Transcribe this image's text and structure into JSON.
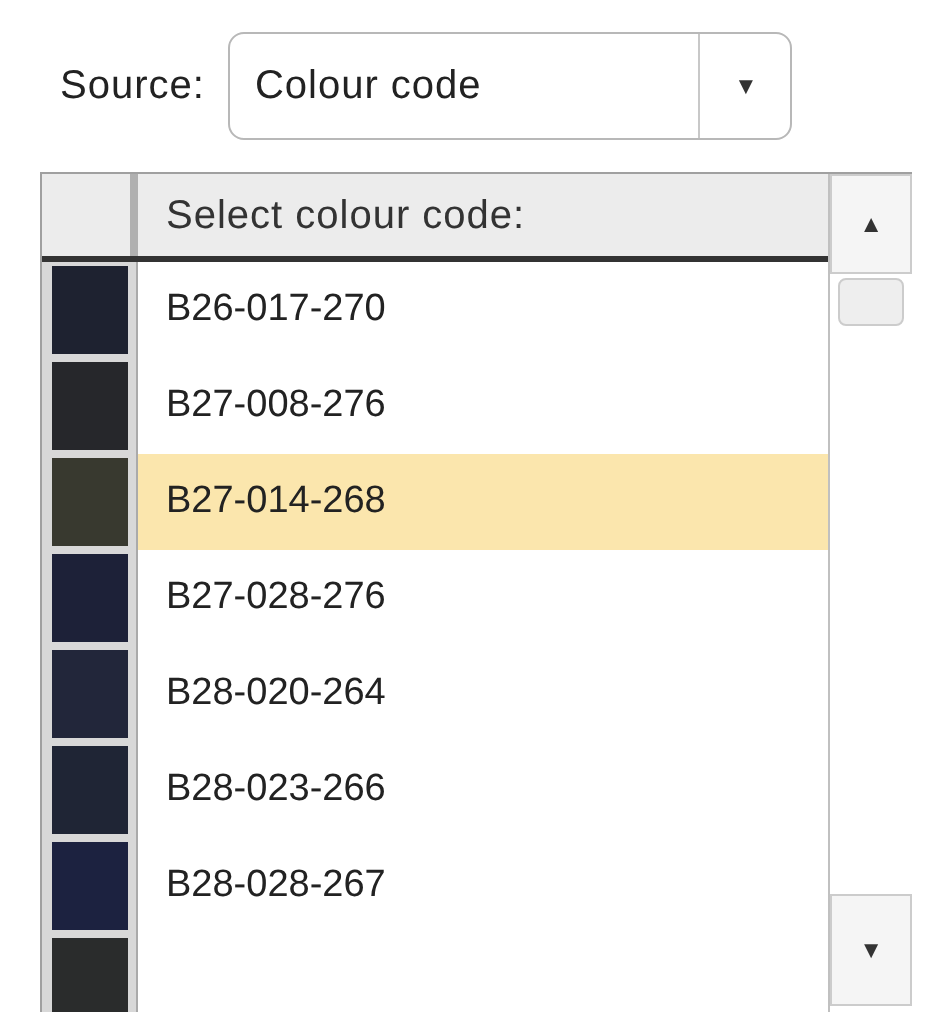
{
  "source": {
    "label": "Source:",
    "value": "Colour code",
    "caret": "▼"
  },
  "table": {
    "header": "Select colour code:",
    "scroll_up": "▲",
    "scroll_down": "▼",
    "rows": [
      {
        "code": "B26-017-270",
        "color": "#1e2230",
        "selected": false
      },
      {
        "code": "B27-008-276",
        "color": "#26272b",
        "selected": false
      },
      {
        "code": "B27-014-268",
        "color": "#38392f",
        "selected": true
      },
      {
        "code": "B27-028-276",
        "color": "#1d2138",
        "selected": false
      },
      {
        "code": "B28-020-264",
        "color": "#22263a",
        "selected": false
      },
      {
        "code": "B28-023-266",
        "color": "#1f2535",
        "selected": false
      },
      {
        "code": "B28-028-267",
        "color": "#1c2240",
        "selected": false
      },
      {
        "color": "#2a2c2c"
      }
    ]
  }
}
